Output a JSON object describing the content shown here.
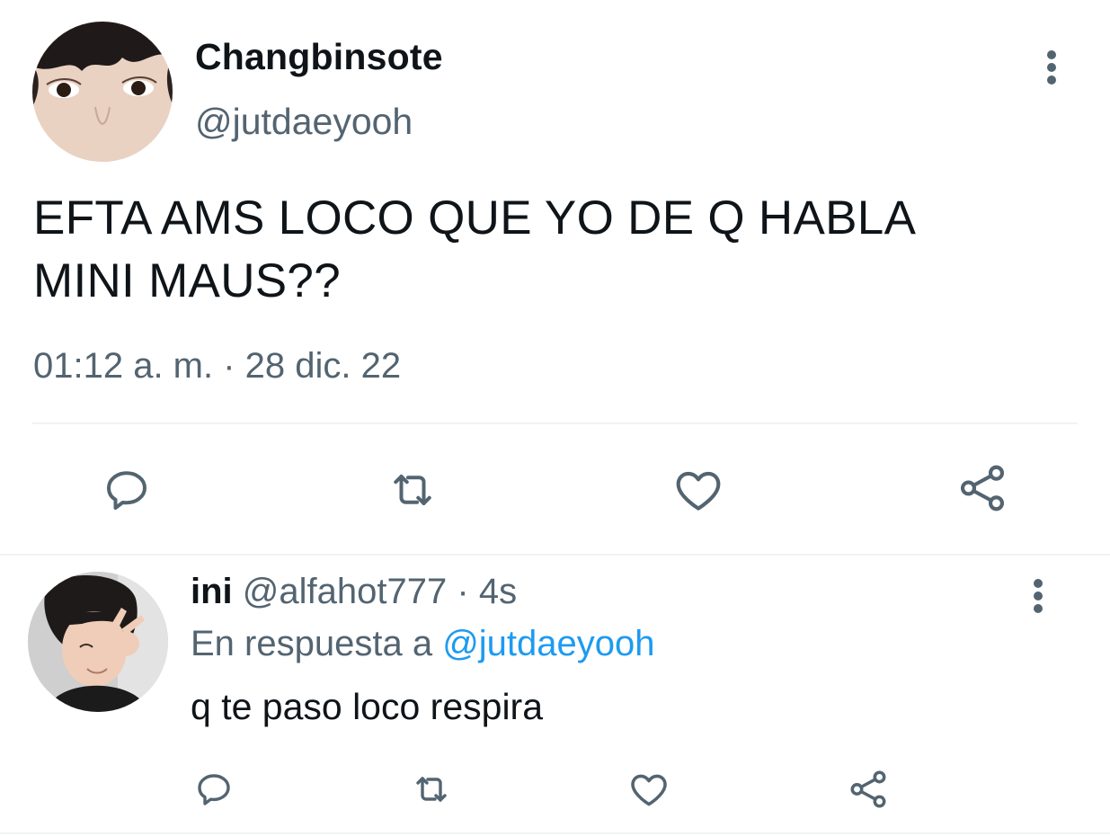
{
  "main_tweet": {
    "display_name": "Changbinsote",
    "handle": "@jutdaeyooh",
    "text_line1": "EFTA AMS LOCO QUE YO DE Q HABLA",
    "text_line2": "MINI MAUS??",
    "timestamp": "01:12 a. m. · 28 dic. 22",
    "actions": [
      "reply-icon",
      "retweet-icon",
      "like-icon",
      "share-icon"
    ]
  },
  "reply_tweet": {
    "display_name": "ini",
    "handle": "@alfahot777",
    "separator": "·",
    "age": "4s",
    "reply_prefix": "En respuesta a",
    "reply_mention": "@jutdaeyooh",
    "text": "q te paso loco respira",
    "actions": [
      "reply-icon",
      "retweet-icon",
      "like-icon",
      "share-icon"
    ]
  },
  "colors": {
    "text_primary": "#0f1419",
    "text_secondary": "#536471",
    "link": "#1d9bf0",
    "divider": "#eff3f4"
  }
}
